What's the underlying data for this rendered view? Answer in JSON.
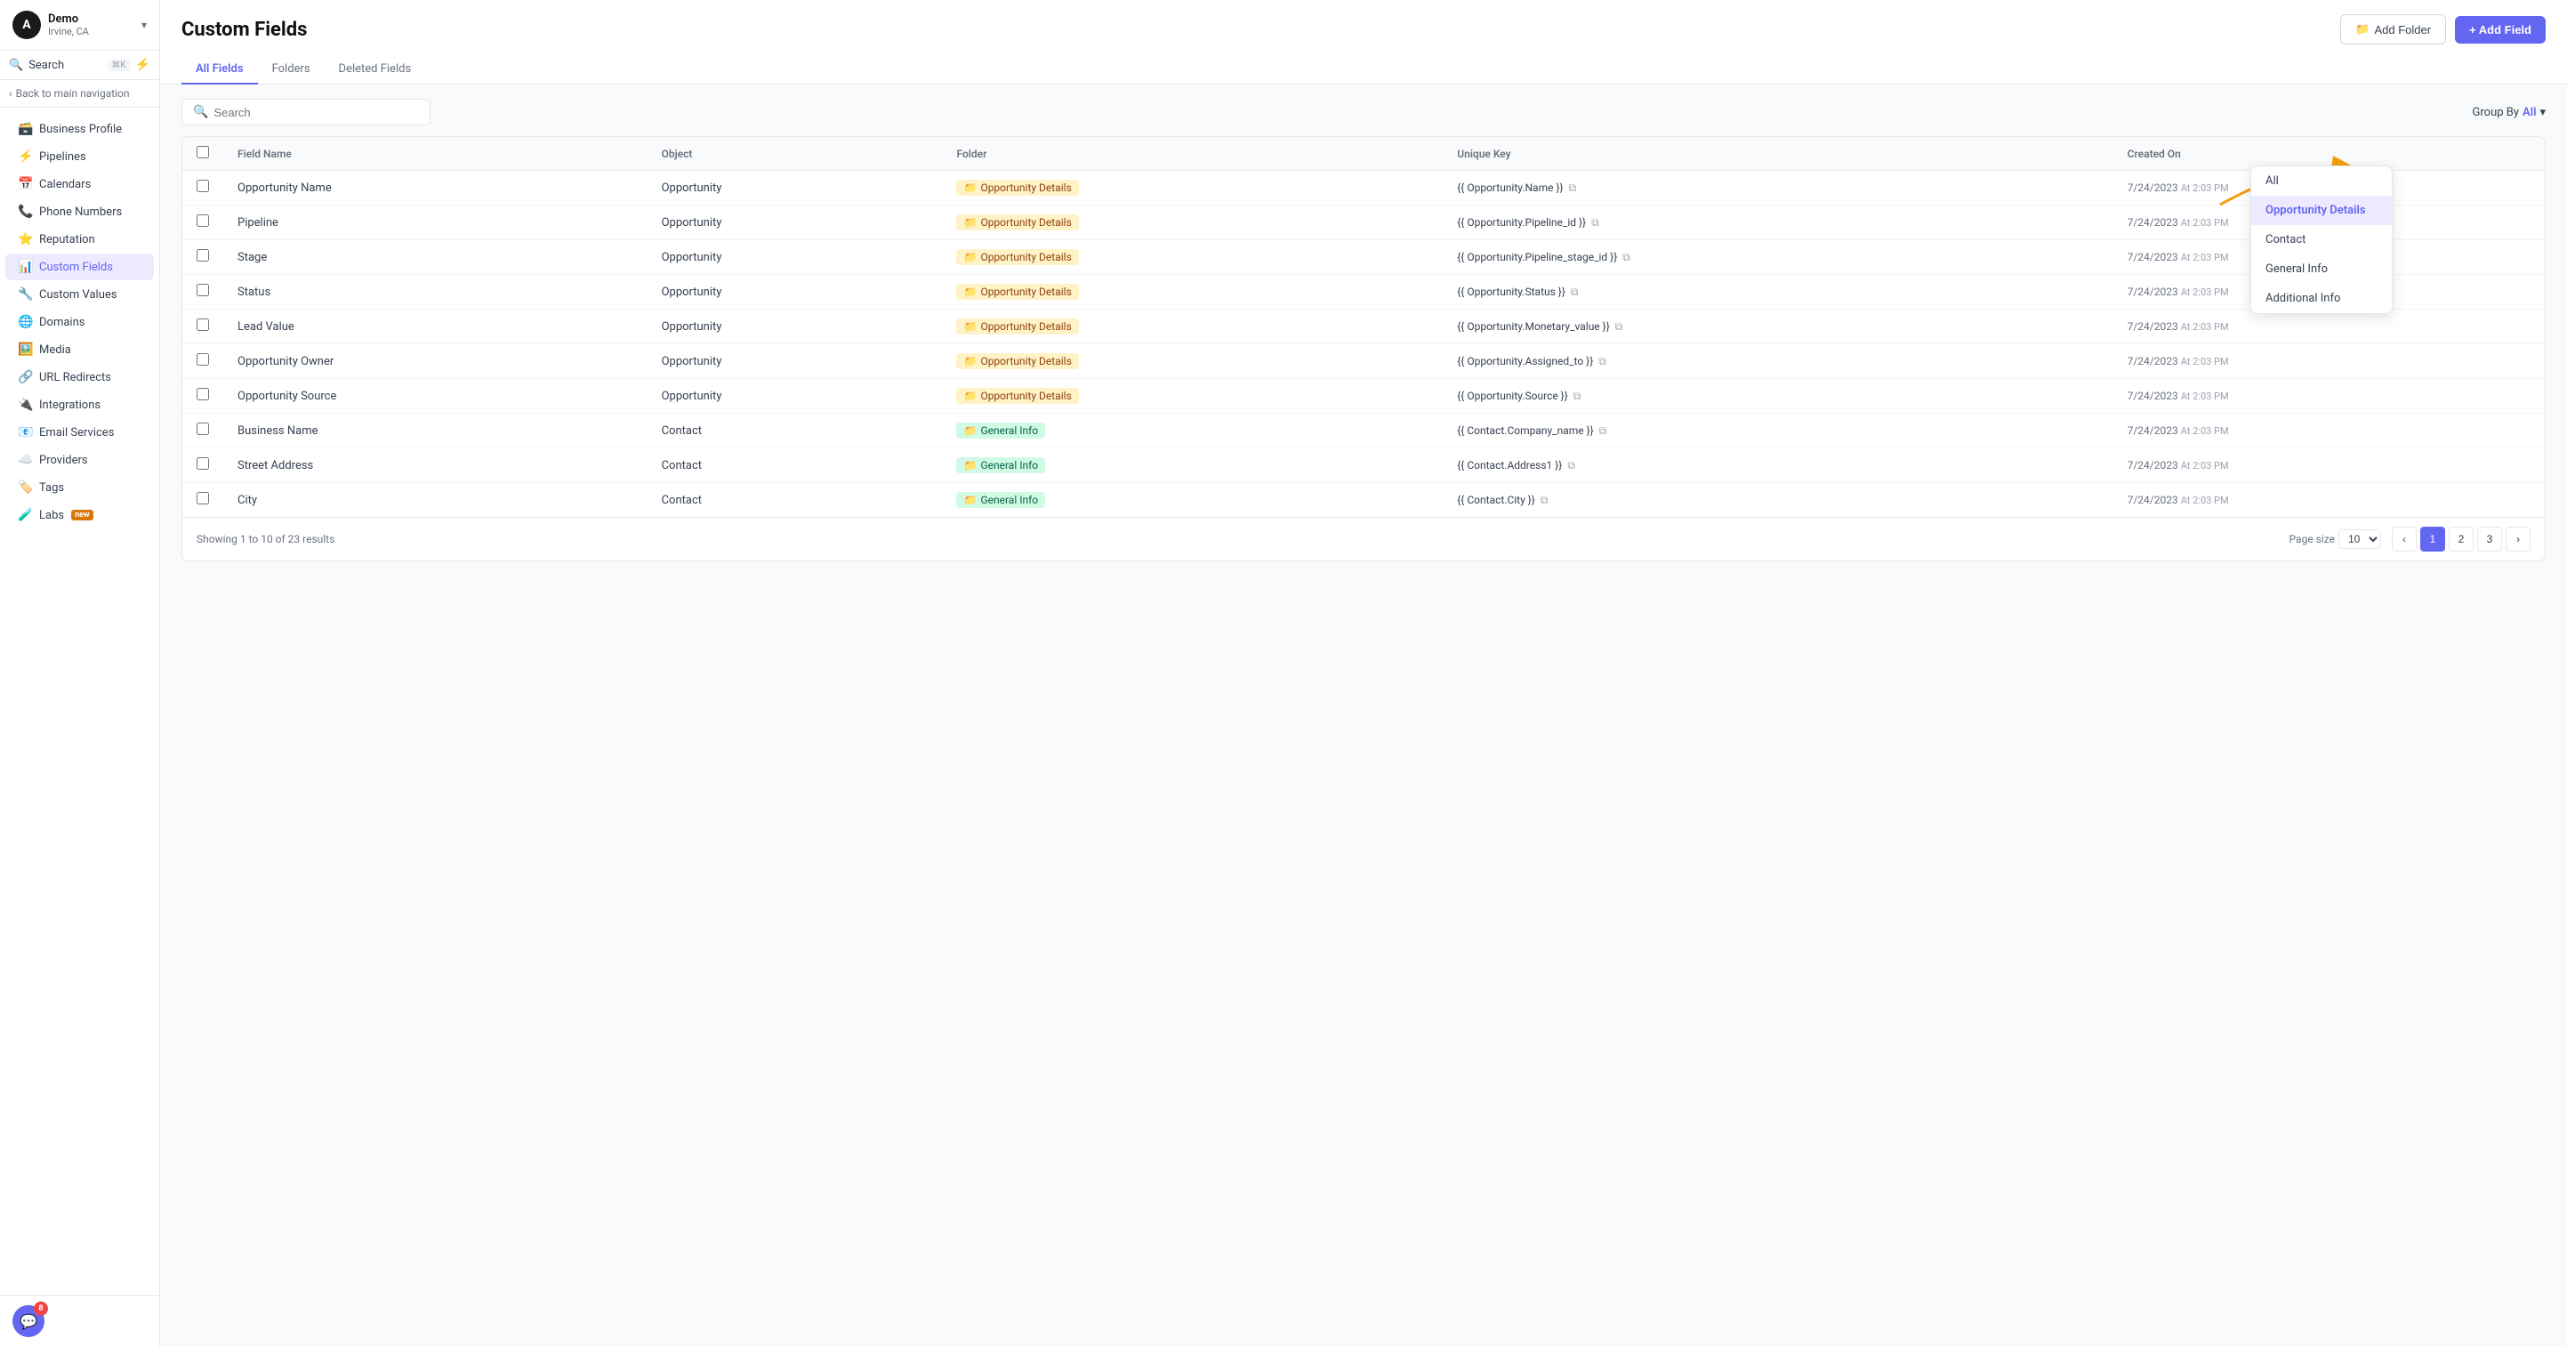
{
  "sidebar": {
    "avatar_letter": "A",
    "demo_name": "Demo",
    "demo_location": "Irvine, CA",
    "search_label": "Search",
    "search_shortcut": "⌘K",
    "back_label": "Back to main navigation",
    "nav_items": [
      {
        "id": "business-profile",
        "label": "Business Profile",
        "icon": "🗃️",
        "active": false
      },
      {
        "id": "pipelines",
        "label": "Pipelines",
        "icon": "⚡",
        "active": false
      },
      {
        "id": "calendars",
        "label": "Calendars",
        "icon": "📅",
        "active": false
      },
      {
        "id": "phone-numbers",
        "label": "Phone Numbers",
        "icon": "📞",
        "active": false
      },
      {
        "id": "reputation",
        "label": "Reputation",
        "icon": "⭐",
        "active": false
      },
      {
        "id": "custom-fields",
        "label": "Custom Fields",
        "icon": "📊",
        "active": true
      },
      {
        "id": "custom-values",
        "label": "Custom Values",
        "icon": "🔧",
        "active": false
      },
      {
        "id": "domains",
        "label": "Domains",
        "icon": "🌐",
        "active": false
      },
      {
        "id": "media",
        "label": "Media",
        "icon": "🖼️",
        "active": false
      },
      {
        "id": "url-redirects",
        "label": "URL Redirects",
        "icon": "🔗",
        "active": false
      },
      {
        "id": "integrations",
        "label": "Integrations",
        "icon": "🔌",
        "active": false
      },
      {
        "id": "email-services",
        "label": "Email Services",
        "icon": "📧",
        "active": false
      },
      {
        "id": "providers",
        "label": "Providers",
        "icon": "☁️",
        "active": false
      },
      {
        "id": "tags",
        "label": "Tags",
        "icon": "🏷️",
        "active": false
      },
      {
        "id": "labs",
        "label": "Labs",
        "icon": "🧪",
        "active": false,
        "badge": "new"
      }
    ],
    "chat_badge": "8"
  },
  "header": {
    "title": "Custom Fields",
    "add_folder_label": "Add Folder",
    "add_field_label": "+ Add Field",
    "tabs": [
      {
        "id": "all-fields",
        "label": "All Fields",
        "active": true
      },
      {
        "id": "folders",
        "label": "Folders",
        "active": false
      },
      {
        "id": "deleted-fields",
        "label": "Deleted Fields",
        "active": false
      }
    ]
  },
  "search": {
    "placeholder": "Search",
    "group_by_label": "Group By",
    "group_by_value": "All"
  },
  "table": {
    "columns": [
      "",
      "Field Name",
      "Object",
      "Folder",
      "Unique Key",
      "Created On"
    ],
    "rows": [
      {
        "field_name": "Opportunity Name",
        "object": "Opportunity",
        "folder": "Opportunity Details",
        "folder_type": "opportunity",
        "unique_key": "{{ Opportunity.Name }}",
        "created_on": "7/24/2023",
        "created_time": "At 2:03 PM"
      },
      {
        "field_name": "Pipeline",
        "object": "Opportunity",
        "folder": "Opportunity Details",
        "folder_type": "opportunity",
        "unique_key": "{{ Opportunity.Pipeline_id }}",
        "created_on": "7/24/2023",
        "created_time": "At 2:03 PM"
      },
      {
        "field_name": "Stage",
        "object": "Opportunity",
        "folder": "Opportunity Details",
        "folder_type": "opportunity",
        "unique_key": "{{ Opportunity.Pipeline_stage_id }}",
        "created_on": "7/24/2023",
        "created_time": "At 2:03 PM"
      },
      {
        "field_name": "Status",
        "object": "Opportunity",
        "folder": "Opportunity Details",
        "folder_type": "opportunity",
        "unique_key": "{{ Opportunity.Status }}",
        "created_on": "7/24/2023",
        "created_time": "At 2:03 PM"
      },
      {
        "field_name": "Lead Value",
        "object": "Opportunity",
        "folder": "Opportunity Details",
        "folder_type": "opportunity",
        "unique_key": "{{ Opportunity.Monetary_value }}",
        "created_on": "7/24/2023",
        "created_time": "At 2:03 PM"
      },
      {
        "field_name": "Opportunity Owner",
        "object": "Opportunity",
        "folder": "Opportunity Details",
        "folder_type": "opportunity",
        "unique_key": "{{ Opportunity.Assigned_to }}",
        "created_on": "7/24/2023",
        "created_time": "At 2:03 PM"
      },
      {
        "field_name": "Opportunity Source",
        "object": "Opportunity",
        "folder": "Opportunity Details",
        "folder_type": "opportunity",
        "unique_key": "{{ Opportunity.Source }}",
        "created_on": "7/24/2023",
        "created_time": "At 2:03 PM"
      },
      {
        "field_name": "Business Name",
        "object": "Contact",
        "folder": "General Info",
        "folder_type": "general",
        "unique_key": "{{ Contact.Company_name }}",
        "created_on": "7/24/2023",
        "created_time": "At 2:03 PM"
      },
      {
        "field_name": "Street Address",
        "object": "Contact",
        "folder": "General Info",
        "folder_type": "general",
        "unique_key": "{{ Contact.Address1 }}",
        "created_on": "7/24/2023",
        "created_time": "At 2:03 PM"
      },
      {
        "field_name": "City",
        "object": "Contact",
        "folder": "General Info",
        "folder_type": "general",
        "unique_key": "{{ Contact.City }}",
        "created_on": "7/24/2023",
        "created_time": "At 2:03 PM"
      }
    ],
    "showing_text": "Showing 1 to 10 of 23 results",
    "page_size_label": "Page size",
    "page_size_value": "10",
    "pages": [
      "1",
      "2",
      "3"
    ]
  },
  "dropdown": {
    "label": "Group By",
    "items": [
      {
        "id": "all",
        "label": "All",
        "selected": false
      },
      {
        "id": "opportunity-details",
        "label": "Opportunity Details",
        "selected": true
      },
      {
        "id": "contact",
        "label": "Contact",
        "selected": false
      },
      {
        "id": "general-info",
        "label": "General Info",
        "selected": false
      },
      {
        "id": "additional-info",
        "label": "Additional Info",
        "selected": false
      }
    ]
  }
}
